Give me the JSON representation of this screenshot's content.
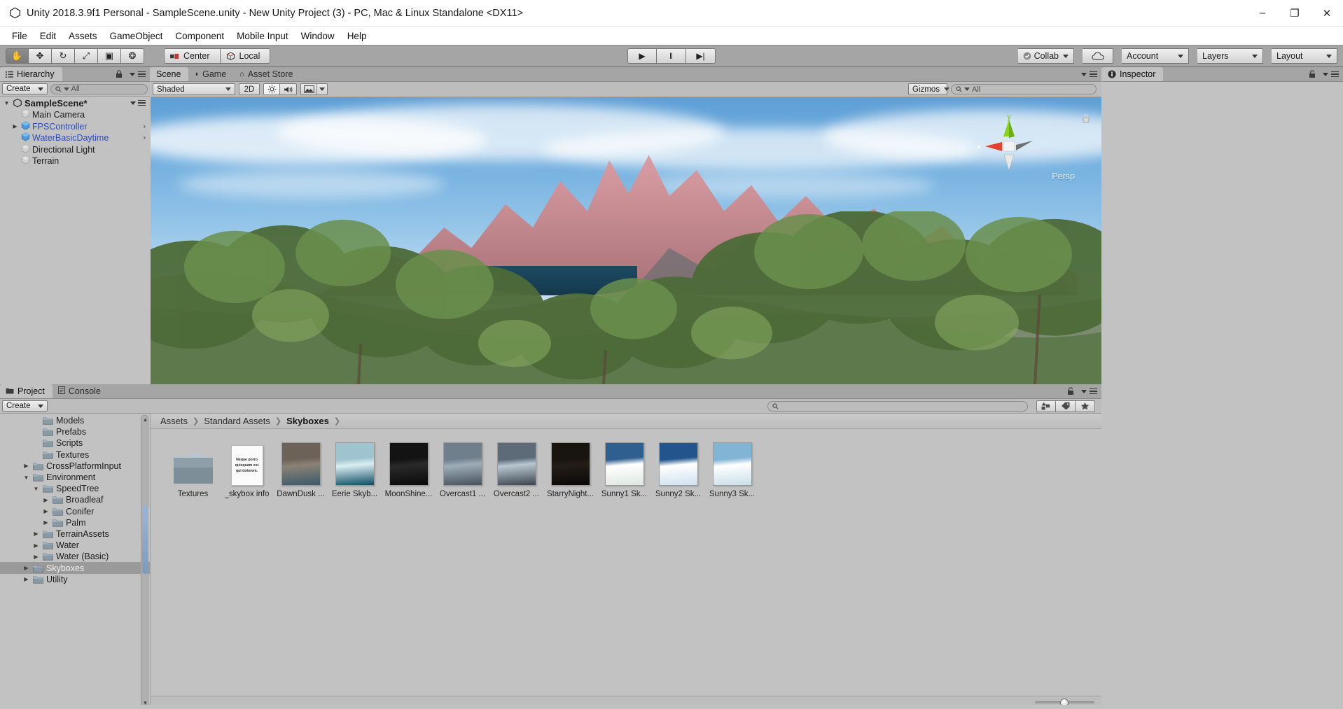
{
  "window": {
    "title": "Unity 2018.3.9f1 Personal - SampleScene.unity - New Unity Project (3) - PC, Mac & Linux Standalone <DX11>",
    "minimize": "–",
    "maximize": "❐",
    "close": "✕"
  },
  "menubar": {
    "items": [
      "File",
      "Edit",
      "Assets",
      "GameObject",
      "Component",
      "Mobile Input",
      "Window",
      "Help"
    ]
  },
  "toolbar": {
    "tools": [
      {
        "name": "hand-tool",
        "glyph": "✋",
        "active": true
      },
      {
        "name": "move-tool",
        "glyph": "✥",
        "active": false
      },
      {
        "name": "rotate-tool",
        "glyph": "↻",
        "active": false
      },
      {
        "name": "scale-tool",
        "glyph": "⤢",
        "active": false
      },
      {
        "name": "rect-tool",
        "glyph": "▣",
        "active": false
      },
      {
        "name": "transform-tool",
        "glyph": "❂",
        "active": false
      }
    ],
    "pivot_mode": "Center",
    "pivot_rotation": "Local",
    "play": "▶",
    "pause": "‖",
    "step": "▶|",
    "collab": "Collab",
    "cloud_icon": "cloud-icon",
    "account": "Account",
    "layers": "Layers",
    "layout": "Layout"
  },
  "hierarchy": {
    "tab": "Hierarchy",
    "create": "Create",
    "search_placeholder": "All",
    "scene_name": "SampleScene*",
    "items": [
      {
        "label": "Main Camera",
        "prefab": false,
        "expandable": false,
        "chevron": false
      },
      {
        "label": "FPSController",
        "prefab": true,
        "expandable": true,
        "chevron": true
      },
      {
        "label": "WaterBasicDaytime",
        "prefab": true,
        "expandable": false,
        "chevron": true
      },
      {
        "label": "Directional Light",
        "prefab": false,
        "expandable": false,
        "chevron": false
      },
      {
        "label": "Terrain",
        "prefab": false,
        "expandable": false,
        "chevron": false
      }
    ]
  },
  "scene_panel": {
    "tabs": [
      {
        "label": "Scene",
        "active": true,
        "icon": ""
      },
      {
        "label": "Game",
        "active": false,
        "icon": "◖"
      },
      {
        "label": "Asset Store",
        "active": false,
        "icon": "⌂"
      }
    ],
    "draw_mode": "Shaded",
    "two_d": "2D",
    "lighting_icon": "☀",
    "audio_icon": "ὐA",
    "fx_icon": "▣",
    "gizmos": "Gizmos",
    "search_placeholder": "All",
    "gizmo_axes": {
      "x": "x",
      "y": "y"
    },
    "projection": "Persp"
  },
  "inspector": {
    "tab": "Inspector"
  },
  "project": {
    "tabs": [
      {
        "label": "Project",
        "active": true
      },
      {
        "label": "Console",
        "active": false
      }
    ],
    "create": "Create",
    "search_placeholder": "",
    "filter_icons": [
      "object-filter-icon",
      "label-filter-icon",
      "favorite-star-icon"
    ],
    "tree": [
      {
        "label": "Models",
        "depth": 3,
        "tri": "",
        "selected": false
      },
      {
        "label": "Prefabs",
        "depth": 3,
        "tri": "",
        "selected": false
      },
      {
        "label": "Scripts",
        "depth": 3,
        "tri": "",
        "selected": false
      },
      {
        "label": "Textures",
        "depth": 3,
        "tri": "",
        "selected": false
      },
      {
        "label": "CrossPlatformInput",
        "depth": 2,
        "tri": "▶",
        "selected": false
      },
      {
        "label": "Environment",
        "depth": 2,
        "tri": "▼",
        "selected": false
      },
      {
        "label": "SpeedTree",
        "depth": 3,
        "tri": "▼",
        "selected": false
      },
      {
        "label": "Broadleaf",
        "depth": 4,
        "tri": "▶",
        "selected": false
      },
      {
        "label": "Conifer",
        "depth": 4,
        "tri": "▶",
        "selected": false
      },
      {
        "label": "Palm",
        "depth": 4,
        "tri": "▶",
        "selected": false
      },
      {
        "label": "TerrainAssets",
        "depth": 3,
        "tri": "▶",
        "selected": false
      },
      {
        "label": "Water",
        "depth": 3,
        "tri": "▶",
        "selected": false
      },
      {
        "label": "Water (Basic)",
        "depth": 3,
        "tri": "▶",
        "selected": false
      },
      {
        "label": "Skyboxes",
        "depth": 2,
        "tri": "▶",
        "selected": true
      },
      {
        "label": "Utility",
        "depth": 2,
        "tri": "▶",
        "selected": false
      }
    ],
    "breadcrumb": [
      "Assets",
      "Standard Assets",
      "Skyboxes"
    ],
    "assets": [
      {
        "label": "Textures",
        "kind": "folder"
      },
      {
        "label": "_skybox info",
        "kind": "text",
        "text": "Neque porro quisquam est qui dolorem."
      },
      {
        "label": "DawnDusk ...",
        "kind": "material",
        "c1": "#6d6258",
        "c2": "#3c5a6b",
        "c3": "#8b8275"
      },
      {
        "label": "Eerie Skyb...",
        "kind": "material",
        "c1": "#9fc4cf",
        "c2": "#0f4b63",
        "c3": "#d9eef2"
      },
      {
        "label": "MoonShine...",
        "kind": "material",
        "c1": "#131313",
        "c2": "#090909",
        "c3": "#2a2a2a"
      },
      {
        "label": "Overcast1 ...",
        "kind": "material",
        "c1": "#6f7f8c",
        "c2": "#46525c",
        "c3": "#9eadb8"
      },
      {
        "label": "Overcast2 ...",
        "kind": "material",
        "c1": "#5d6b78",
        "c2": "#3b454e",
        "c3": "#b9c7d1"
      },
      {
        "label": "StarryNight...",
        "kind": "material",
        "c1": "#181410",
        "c2": "#0a0908",
        "c3": "#241d18"
      },
      {
        "label": "Sunny1 Sk...",
        "kind": "material",
        "c1": "#2f5f8f",
        "c2": "#dfe7e0",
        "c3": "#ffffff"
      },
      {
        "label": "Sunny2 Sk...",
        "kind": "material",
        "c1": "#23558c",
        "c2": "#cfe2ef",
        "c3": "#ffffff"
      },
      {
        "label": "Sunny3 Sk...",
        "kind": "material",
        "c1": "#82b4d4",
        "c2": "#c9dfe7",
        "c3": "#ffffff"
      }
    ]
  },
  "colors": {
    "chrome": "#c2c2c2",
    "toolbar": "#a5a5a5",
    "selection": "#9a9a9a",
    "prefab_blue": "#2b4cb8",
    "axis_x": "#e1442d",
    "axis_y": "#8ad11c",
    "axis_z": "#6f6f6f"
  }
}
